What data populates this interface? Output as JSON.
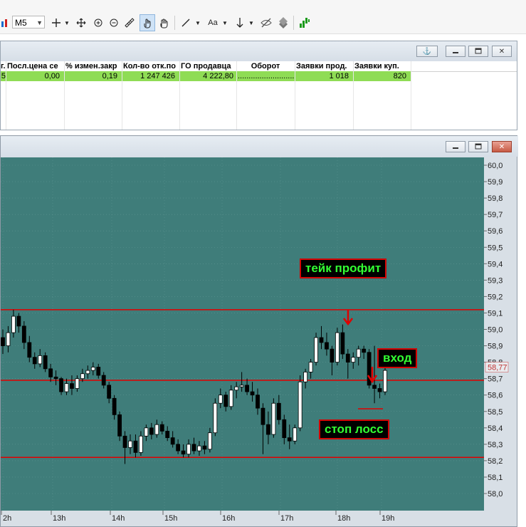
{
  "toolbar": {
    "timeframe": "M5",
    "font_button": "Aa"
  },
  "quote_table": {
    "columns": [
      "г.",
      "Посл.цена се",
      "% измен.закр",
      "Кол-во отк.по",
      "ГО продавца",
      "Оборот",
      "Заявки прод.",
      "Заявки куп."
    ],
    "row": [
      "5",
      "0,00",
      "0,19",
      "1 247 426",
      "4 222,80",
      ".............................",
      "1 018",
      "820"
    ]
  },
  "chart_data": {
    "type": "candlestick",
    "y_ticks": [
      "60,0",
      "59,9",
      "59,8",
      "59,7",
      "59,6",
      "59,5",
      "59,4",
      "59,3",
      "59,2",
      "59,1",
      "59,0",
      "58,9",
      "58,8",
      "58,7",
      "58,6",
      "58,5",
      "58,4",
      "58,3",
      "58,2",
      "58,1",
      "58,0"
    ],
    "ylim": [
      58.0,
      60.0
    ],
    "x_labels": [
      "2h",
      "13h",
      "14h",
      "15h",
      "16h",
      "17h",
      "18h",
      "19h"
    ],
    "last_price": "58,77",
    "levels": [
      59.12,
      58.69,
      58.22
    ],
    "candles": [
      {
        "o": 58.95,
        "h": 59.0,
        "l": 58.85,
        "c": 58.9
      },
      {
        "o": 58.9,
        "h": 59.02,
        "l": 58.86,
        "c": 58.98
      },
      {
        "o": 58.98,
        "h": 59.12,
        "l": 58.95,
        "c": 59.08
      },
      {
        "o": 59.08,
        "h": 59.1,
        "l": 58.98,
        "c": 59.02
      },
      {
        "o": 59.02,
        "h": 59.05,
        "l": 58.88,
        "c": 58.92
      },
      {
        "o": 58.92,
        "h": 58.96,
        "l": 58.8,
        "c": 58.83
      },
      {
        "o": 58.83,
        "h": 58.86,
        "l": 58.76,
        "c": 58.79
      },
      {
        "o": 58.79,
        "h": 58.88,
        "l": 58.77,
        "c": 58.84
      },
      {
        "o": 58.84,
        "h": 58.86,
        "l": 58.74,
        "c": 58.76
      },
      {
        "o": 58.76,
        "h": 58.79,
        "l": 58.68,
        "c": 58.71
      },
      {
        "o": 58.71,
        "h": 58.75,
        "l": 58.66,
        "c": 58.7
      },
      {
        "o": 58.7,
        "h": 58.71,
        "l": 58.6,
        "c": 58.62
      },
      {
        "o": 58.62,
        "h": 58.7,
        "l": 58.6,
        "c": 58.67
      },
      {
        "o": 58.67,
        "h": 58.72,
        "l": 58.6,
        "c": 58.64
      },
      {
        "o": 58.64,
        "h": 58.72,
        "l": 58.62,
        "c": 58.7
      },
      {
        "o": 58.7,
        "h": 58.76,
        "l": 58.68,
        "c": 58.73
      },
      {
        "o": 58.73,
        "h": 58.78,
        "l": 58.7,
        "c": 58.75
      },
      {
        "o": 58.75,
        "h": 58.8,
        "l": 58.72,
        "c": 58.77
      },
      {
        "o": 58.77,
        "h": 58.79,
        "l": 58.7,
        "c": 58.72
      },
      {
        "o": 58.72,
        "h": 58.74,
        "l": 58.64,
        "c": 58.66
      },
      {
        "o": 58.66,
        "h": 58.68,
        "l": 58.55,
        "c": 58.58
      },
      {
        "o": 58.58,
        "h": 58.6,
        "l": 58.45,
        "c": 58.48
      },
      {
        "o": 58.48,
        "h": 58.5,
        "l": 58.32,
        "c": 58.35
      },
      {
        "o": 58.35,
        "h": 58.38,
        "l": 58.18,
        "c": 58.28
      },
      {
        "o": 58.28,
        "h": 58.36,
        "l": 58.24,
        "c": 58.32
      },
      {
        "o": 58.32,
        "h": 58.36,
        "l": 58.22,
        "c": 58.25
      },
      {
        "o": 58.25,
        "h": 58.38,
        "l": 58.23,
        "c": 58.35
      },
      {
        "o": 58.35,
        "h": 58.42,
        "l": 58.32,
        "c": 58.4
      },
      {
        "o": 58.4,
        "h": 58.43,
        "l": 58.33,
        "c": 58.36
      },
      {
        "o": 58.36,
        "h": 58.45,
        "l": 58.34,
        "c": 58.42
      },
      {
        "o": 58.42,
        "h": 58.44,
        "l": 58.36,
        "c": 58.38
      },
      {
        "o": 58.38,
        "h": 58.41,
        "l": 58.32,
        "c": 58.34
      },
      {
        "o": 58.34,
        "h": 58.38,
        "l": 58.28,
        "c": 58.3
      },
      {
        "o": 58.3,
        "h": 58.33,
        "l": 58.24,
        "c": 58.26
      },
      {
        "o": 58.26,
        "h": 58.3,
        "l": 58.22,
        "c": 58.24
      },
      {
        "o": 58.24,
        "h": 58.33,
        "l": 58.22,
        "c": 58.3
      },
      {
        "o": 58.3,
        "h": 58.34,
        "l": 58.24,
        "c": 58.26
      },
      {
        "o": 58.26,
        "h": 58.32,
        "l": 58.23,
        "c": 58.29
      },
      {
        "o": 58.29,
        "h": 58.32,
        "l": 58.24,
        "c": 58.27
      },
      {
        "o": 58.27,
        "h": 58.4,
        "l": 58.25,
        "c": 58.37
      },
      {
        "o": 58.37,
        "h": 58.58,
        "l": 58.35,
        "c": 58.55
      },
      {
        "o": 58.55,
        "h": 58.64,
        "l": 58.52,
        "c": 58.6
      },
      {
        "o": 58.6,
        "h": 58.62,
        "l": 58.5,
        "c": 58.53
      },
      {
        "o": 58.53,
        "h": 58.66,
        "l": 58.51,
        "c": 58.63
      },
      {
        "o": 58.63,
        "h": 58.68,
        "l": 58.58,
        "c": 58.65
      },
      {
        "o": 58.65,
        "h": 58.74,
        "l": 58.62,
        "c": 58.66
      },
      {
        "o": 58.66,
        "h": 58.7,
        "l": 58.6,
        "c": 58.62
      },
      {
        "o": 58.62,
        "h": 58.68,
        "l": 58.56,
        "c": 58.6
      },
      {
        "o": 58.6,
        "h": 58.64,
        "l": 58.48,
        "c": 58.52
      },
      {
        "o": 58.52,
        "h": 58.55,
        "l": 58.24,
        "c": 58.42
      },
      {
        "o": 58.42,
        "h": 58.5,
        "l": 58.3,
        "c": 58.36
      },
      {
        "o": 58.36,
        "h": 58.58,
        "l": 58.34,
        "c": 58.55
      },
      {
        "o": 58.55,
        "h": 58.6,
        "l": 58.42,
        "c": 58.45
      },
      {
        "o": 58.45,
        "h": 58.48,
        "l": 58.3,
        "c": 58.34
      },
      {
        "o": 58.34,
        "h": 58.42,
        "l": 58.27,
        "c": 58.32
      },
      {
        "o": 58.32,
        "h": 58.42,
        "l": 58.3,
        "c": 58.4
      },
      {
        "o": 58.4,
        "h": 58.72,
        "l": 58.38,
        "c": 58.68
      },
      {
        "o": 58.68,
        "h": 58.76,
        "l": 58.64,
        "c": 58.74
      },
      {
        "o": 58.74,
        "h": 58.82,
        "l": 58.7,
        "c": 58.8
      },
      {
        "o": 58.8,
        "h": 58.98,
        "l": 58.78,
        "c": 58.95
      },
      {
        "o": 58.95,
        "h": 59.02,
        "l": 58.88,
        "c": 58.92
      },
      {
        "o": 58.92,
        "h": 58.98,
        "l": 58.84,
        "c": 58.88
      },
      {
        "o": 58.88,
        "h": 58.9,
        "l": 58.72,
        "c": 58.8
      },
      {
        "o": 58.8,
        "h": 59.01,
        "l": 58.78,
        "c": 58.98
      },
      {
        "o": 58.98,
        "h": 59.03,
        "l": 58.82,
        "c": 58.85
      },
      {
        "o": 58.85,
        "h": 58.88,
        "l": 58.7,
        "c": 58.8
      },
      {
        "o": 58.8,
        "h": 58.86,
        "l": 58.76,
        "c": 58.83
      },
      {
        "o": 58.83,
        "h": 58.9,
        "l": 58.78,
        "c": 58.88
      },
      {
        "o": 58.88,
        "h": 58.9,
        "l": 58.82,
        "c": 58.86
      },
      {
        "o": 58.86,
        "h": 58.88,
        "l": 58.64,
        "c": 58.66
      },
      {
        "o": 58.66,
        "h": 58.9,
        "l": 58.55,
        "c": 58.64
      },
      {
        "o": 58.64,
        "h": 58.67,
        "l": 58.58,
        "c": 58.62
      },
      {
        "o": 58.62,
        "h": 58.78,
        "l": 58.6,
        "c": 58.75
      }
    ],
    "annotations": [
      "тейк профит",
      "вход",
      "стоп лосс"
    ]
  },
  "colors": {
    "chart_bg": "#3f7d7a",
    "grid": "#5f9592",
    "level_line": "#e00000",
    "label_text": "#33ff33",
    "axis_bg": "#d8dfe6",
    "quote_row": "#8fdc55"
  },
  "icons": [
    "crosshair-icon",
    "move-icon",
    "zoom-in-icon",
    "zoom-out-icon",
    "ruler-icon",
    "hand-up-icon",
    "hand-icon",
    "line-tool-icon",
    "arrow-down-icon",
    "hide-icon",
    "layers-icon",
    "indicators-icon",
    "anchor-icon",
    "minimize-icon",
    "restore-icon",
    "close-icon"
  ]
}
